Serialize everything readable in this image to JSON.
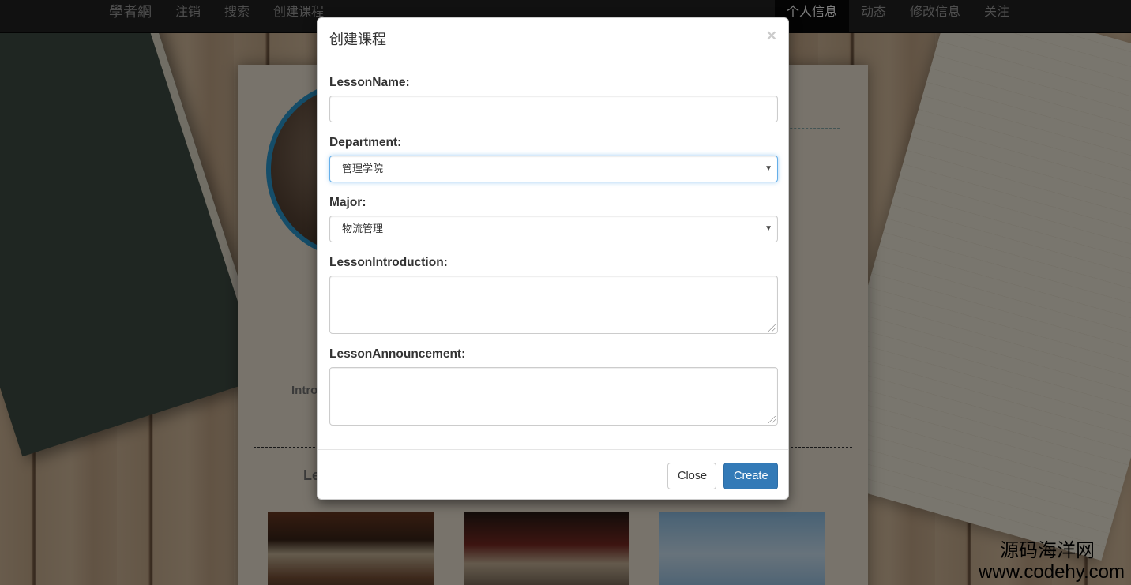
{
  "navbar": {
    "brand": "學者網",
    "left_items": [
      "注销",
      "搜索",
      "创建课程"
    ],
    "right_items": [
      {
        "label": "个人信息",
        "active": true
      },
      {
        "label": "动态",
        "active": false
      },
      {
        "label": "修改信息",
        "active": false
      },
      {
        "label": "关注",
        "active": false
      }
    ]
  },
  "background": {
    "intro_peek": "Intro",
    "lesson_peek": "Le"
  },
  "modal": {
    "title": "创建课程",
    "close_glyph": "×",
    "fields": {
      "lesson_name": {
        "label": "LessonName:",
        "value": ""
      },
      "department": {
        "label": "Department:",
        "selected": "管理学院"
      },
      "major": {
        "label": "Major:",
        "selected": "物流管理"
      },
      "lesson_introduction": {
        "label": "LessonIntroduction:",
        "value": ""
      },
      "lesson_announcement": {
        "label": "LessonAnnouncement:",
        "value": ""
      }
    },
    "buttons": {
      "close": "Close",
      "create": "Create"
    }
  },
  "watermark": {
    "line1": "源码海洋网",
    "line2": "www.codehy.com"
  },
  "colors": {
    "primary": "#337ab7",
    "navbar_bg": "#222222",
    "focus_border": "#66afe9"
  }
}
